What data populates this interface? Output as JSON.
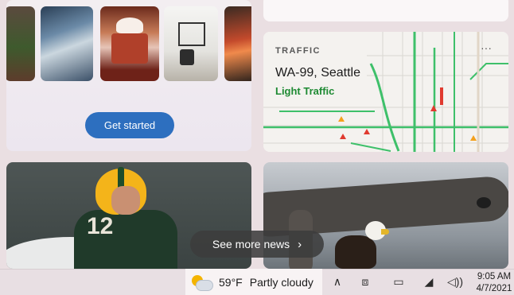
{
  "interests_card": {
    "button_label": "Get started",
    "thumbnails": [
      "garden-photo",
      "city-skyline-photo",
      "cake-photo",
      "interior-photo",
      "car-photo"
    ]
  },
  "traffic_card": {
    "label": "TRAFFIC",
    "title": "WA-99, Seattle",
    "status": "Light Traffic",
    "more": "···",
    "status_color": "#1e8a33"
  },
  "news_pill": {
    "label": "See more news",
    "chevron": "›"
  },
  "taskbar": {
    "weather": {
      "temperature": "59°F",
      "condition": "Partly cloudy",
      "icon": "partly-cloudy-icon"
    },
    "tray": {
      "chevron": "∧",
      "meet": "⧈",
      "battery": "▭",
      "wifi": "◢",
      "volume": "◁))"
    },
    "clock": {
      "time": "9:05 AM",
      "date": "4/7/2021"
    }
  },
  "colors": {
    "accent": "#2d6fbf",
    "taskbar": "#e8dfe3"
  }
}
